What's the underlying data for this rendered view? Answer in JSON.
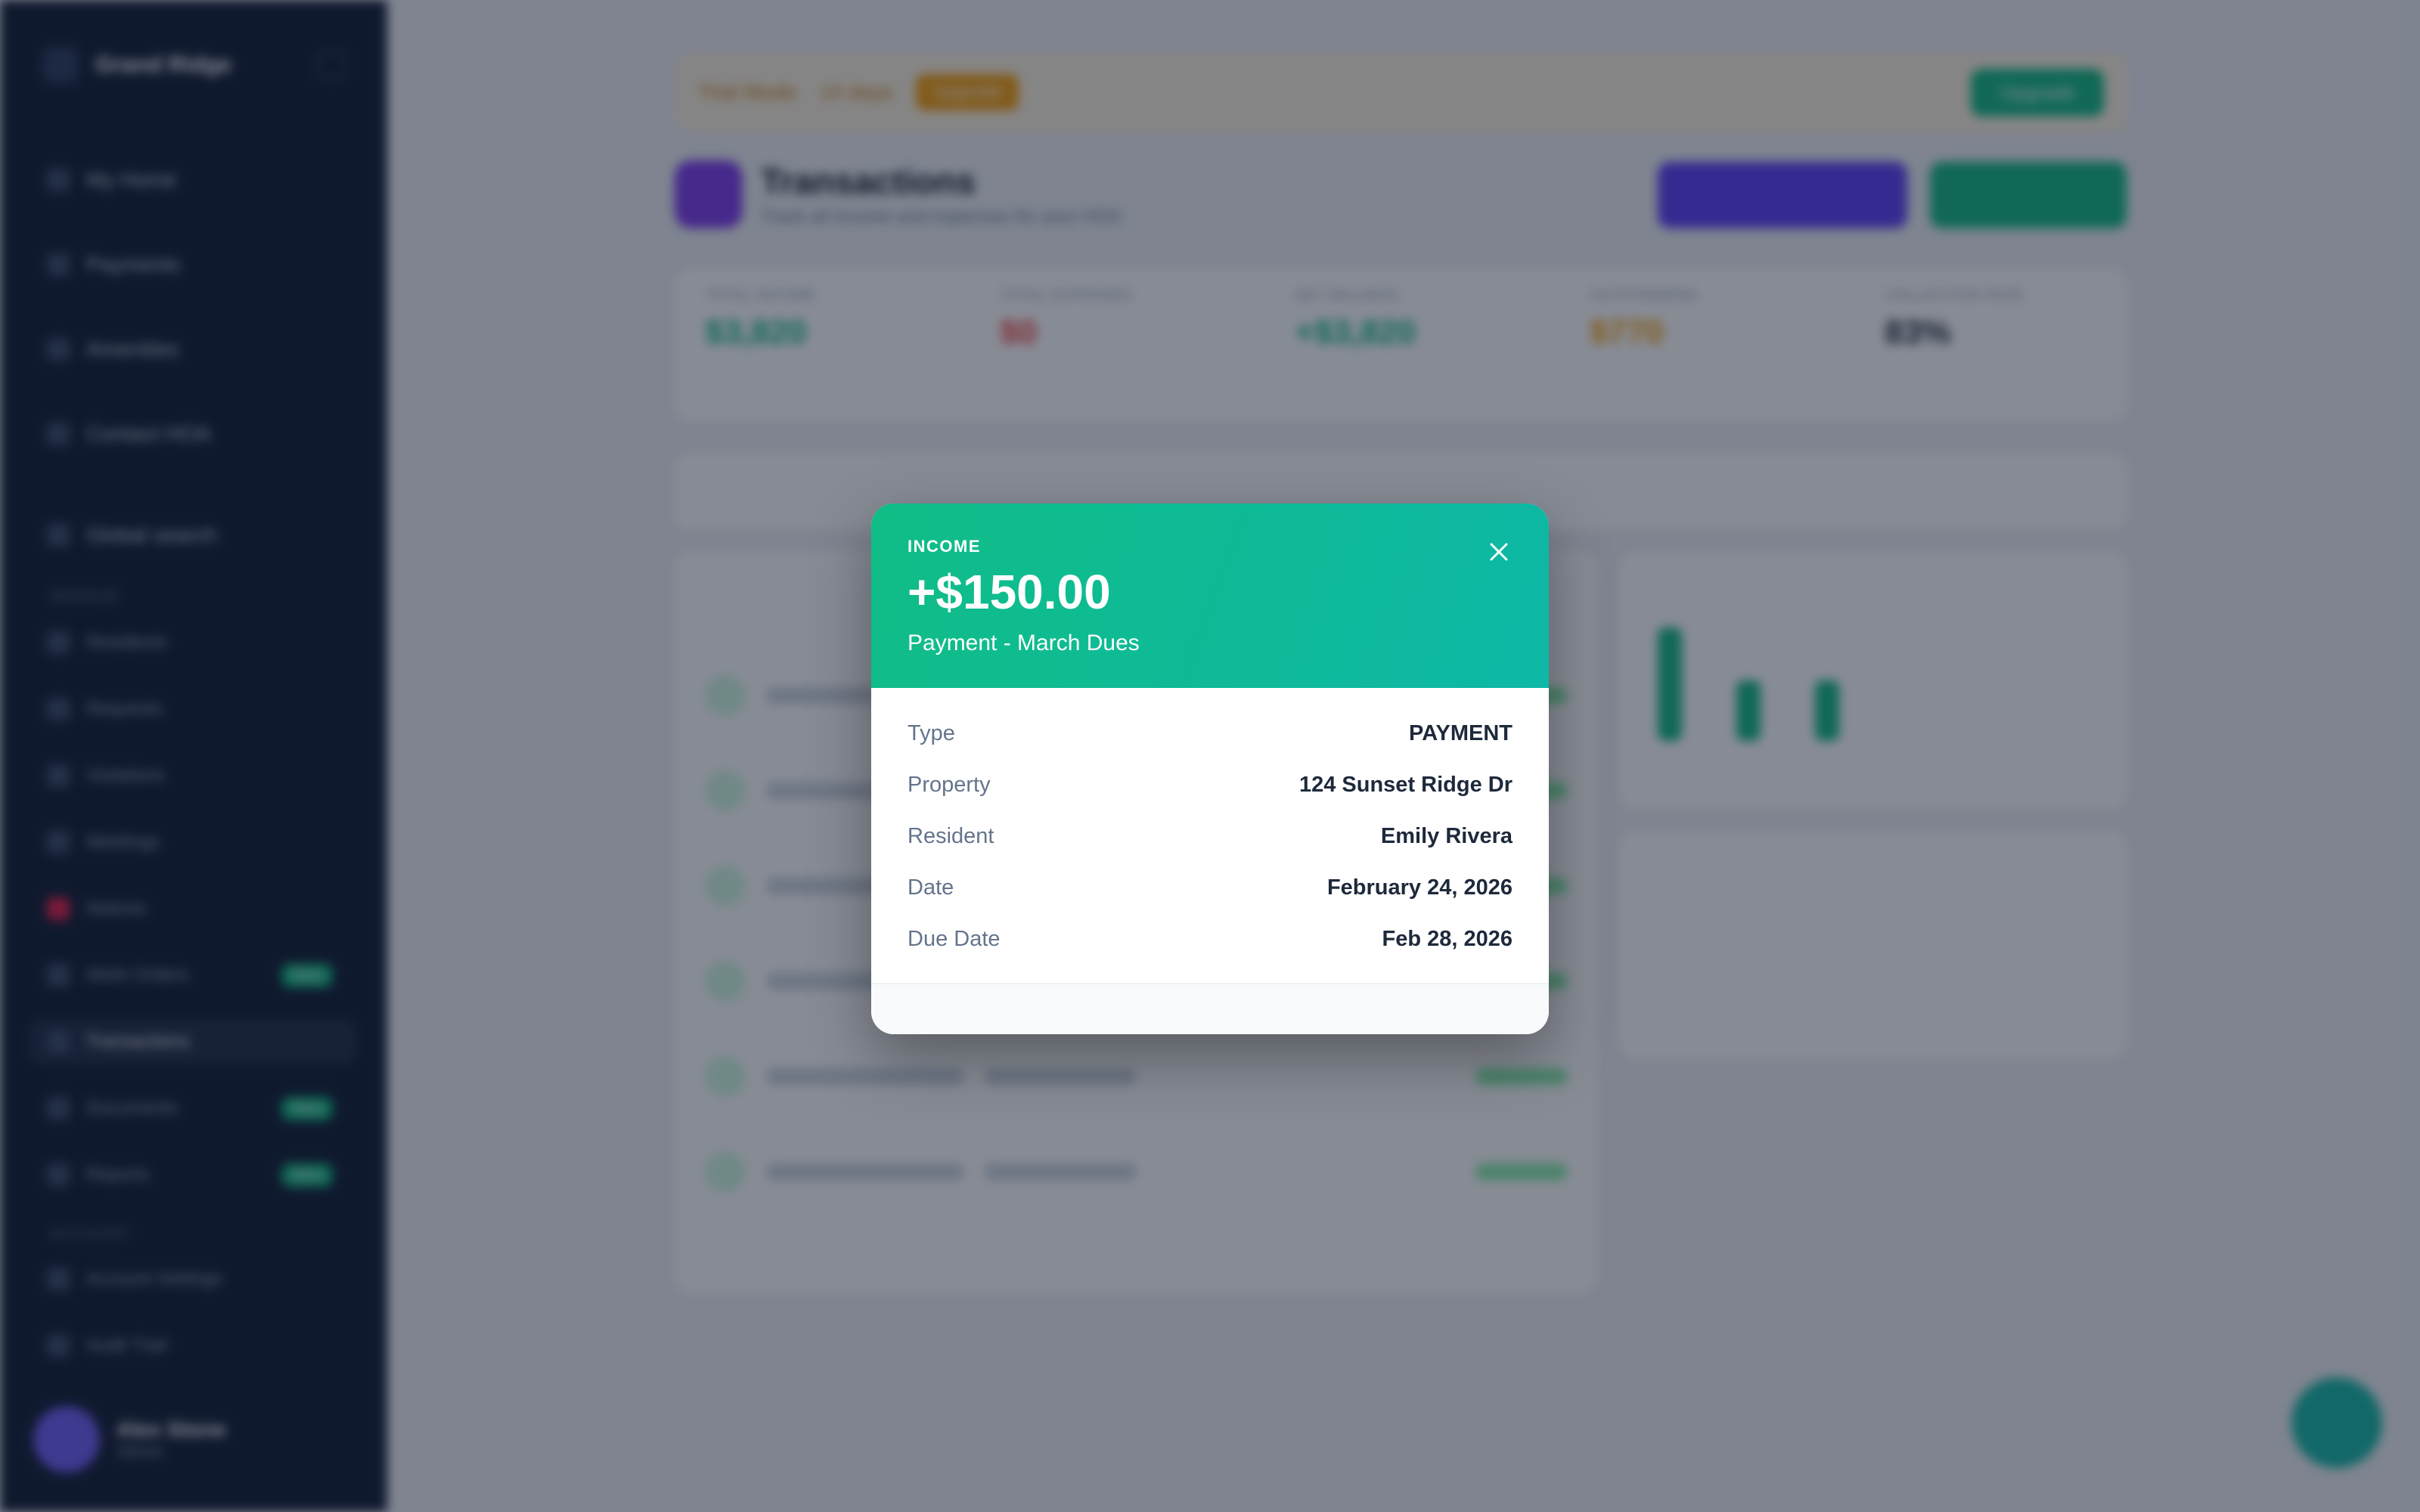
{
  "sidebar": {
    "brand": "Grand Ridge",
    "items": [
      {
        "label": "My Home"
      },
      {
        "label": "Payments"
      },
      {
        "label": "Amenities"
      },
      {
        "label": "Contact HOA"
      },
      {
        "label": "Global search"
      }
    ],
    "section_manage": "MANAGE",
    "manage_items": [
      {
        "label": "Residents"
      },
      {
        "label": "Requests"
      },
      {
        "label": "Violations"
      },
      {
        "label": "Meetings"
      },
      {
        "label": "Notices"
      },
      {
        "label": "Work Orders",
        "badge": "New"
      },
      {
        "label": "Transactions"
      },
      {
        "label": "Documents",
        "badge": "New"
      },
      {
        "label": "Reports",
        "badge": "New"
      }
    ],
    "section_account": "ACCOUNT",
    "account_items": [
      {
        "label": "Account Settings"
      },
      {
        "label": "Audit Trail"
      }
    ],
    "user": {
      "name": "Alex Stone",
      "role": "Admin"
    }
  },
  "main": {
    "banner": {
      "text": "Trial Mode",
      "text2": "14 days",
      "pill": "Upgrade",
      "button": "Upgrade"
    },
    "page_title": "Transactions",
    "page_subtitle": "Track all income and expenses for your HOA",
    "stats": [
      {
        "label": "TOTAL INCOME",
        "value": "$3,820"
      },
      {
        "label": "TOTAL EXPENSES",
        "value": "$0"
      },
      {
        "label": "NET BALANCE",
        "value": "+$3,820"
      },
      {
        "label": "OUTSTANDING",
        "value": "$770"
      },
      {
        "label": "COLLECTION RATE",
        "value": "83%"
      }
    ]
  },
  "modal": {
    "kind": "INCOME",
    "amount": "+$150.00",
    "description": "Payment - March Dues",
    "details": [
      {
        "label": "Type",
        "value": "PAYMENT"
      },
      {
        "label": "Property",
        "value": "124 Sunset Ridge Dr"
      },
      {
        "label": "Resident",
        "value": "Emily Rivera"
      },
      {
        "label": "Date",
        "value": "February 24, 2026"
      },
      {
        "label": "Due Date",
        "value": "Feb 28, 2026"
      }
    ]
  },
  "colors": {
    "modal_header_start": "#10bd86",
    "modal_header_end": "#0db8a6",
    "sidebar_bg": "#0f1b33",
    "overlay": "rgba(15,23,42,0.5)"
  },
  "icons": {
    "close": "close-icon"
  }
}
